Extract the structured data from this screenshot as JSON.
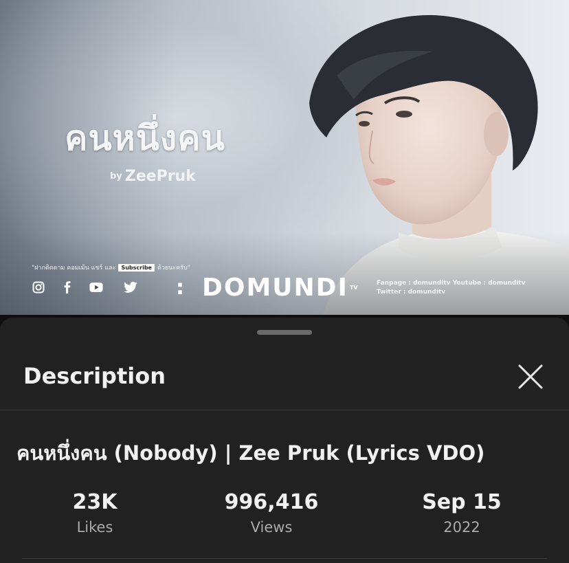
{
  "thumbnail": {
    "title": "คนหนึ่งคน",
    "by": "by",
    "artist": "ZeePruk",
    "promo_left": "\"ฝากติดตาม คอมเม้น แชร์ และ",
    "promo_button": "Subscribe",
    "promo_right": "ด้วยนะครับ\"",
    "social_icons": [
      "instagram-icon",
      "facebook-icon",
      "youtube-icon",
      "twitter-icon"
    ],
    "brand_colon": ":",
    "brand": "DOMUNDI",
    "brand_suffix": "TV",
    "channel_line1": "Fanpage : domunditv Youtube : domunditv",
    "channel_line2": "Twitter : domunditv"
  },
  "sheet": {
    "title": "Description",
    "close_icon": "close-icon",
    "video_title": "คนหนึ่งคน (Nobody) | Zee Pruk (Lyrics VDO)",
    "stats": [
      {
        "value": "23K",
        "label": "Likes"
      },
      {
        "value": "996,416",
        "label": "Views"
      },
      {
        "value": "Sep 15",
        "label": "2022"
      }
    ]
  },
  "colors": {
    "sheet_background": "#212121",
    "primary_text": "#f1f1f1",
    "secondary_text": "#aaaaaa"
  }
}
